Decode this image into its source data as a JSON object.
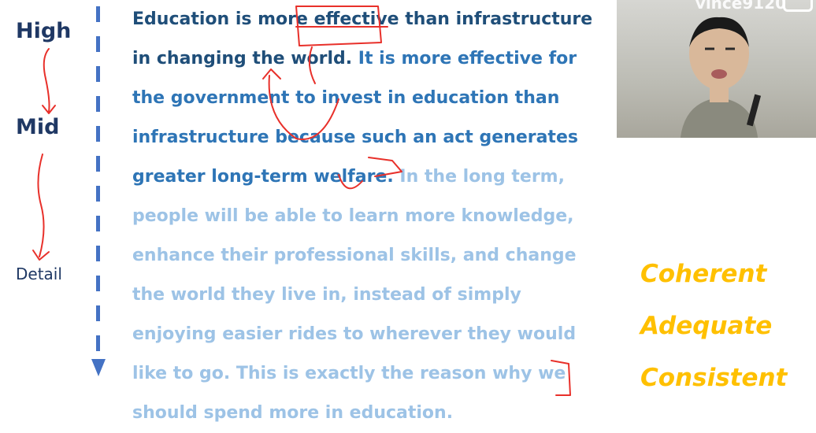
{
  "levels": {
    "high": "High",
    "mid": "Mid",
    "detail": "Detail"
  },
  "paragraph": {
    "sentence_1": "Education is more effective than infrastructure in changing the world.",
    "sentence_2": "It is more effective for the government to invest in education than infrastructure because such an act generates greater long-term welfare.",
    "sentence_3": "In the long term, people will be able to learn more knowledge, enhance their professional skills, and change the world they live in, instead of simply enjoying easier rides to wherever they would like to go. This is exactly the reason why we should spend more in education."
  },
  "keywords": [
    "Coherent",
    "Adequate",
    "Consistent"
  ],
  "video": {
    "watermark": "vince9120"
  },
  "colors": {
    "level_text": "#1f3864",
    "sentence_1": "#1f4e79",
    "sentence_2": "#2e75b6",
    "sentence_3": "#9dc3e6",
    "keywords": "#ffc000",
    "dash_line": "#4472c4",
    "annotation": "#e8302a"
  }
}
